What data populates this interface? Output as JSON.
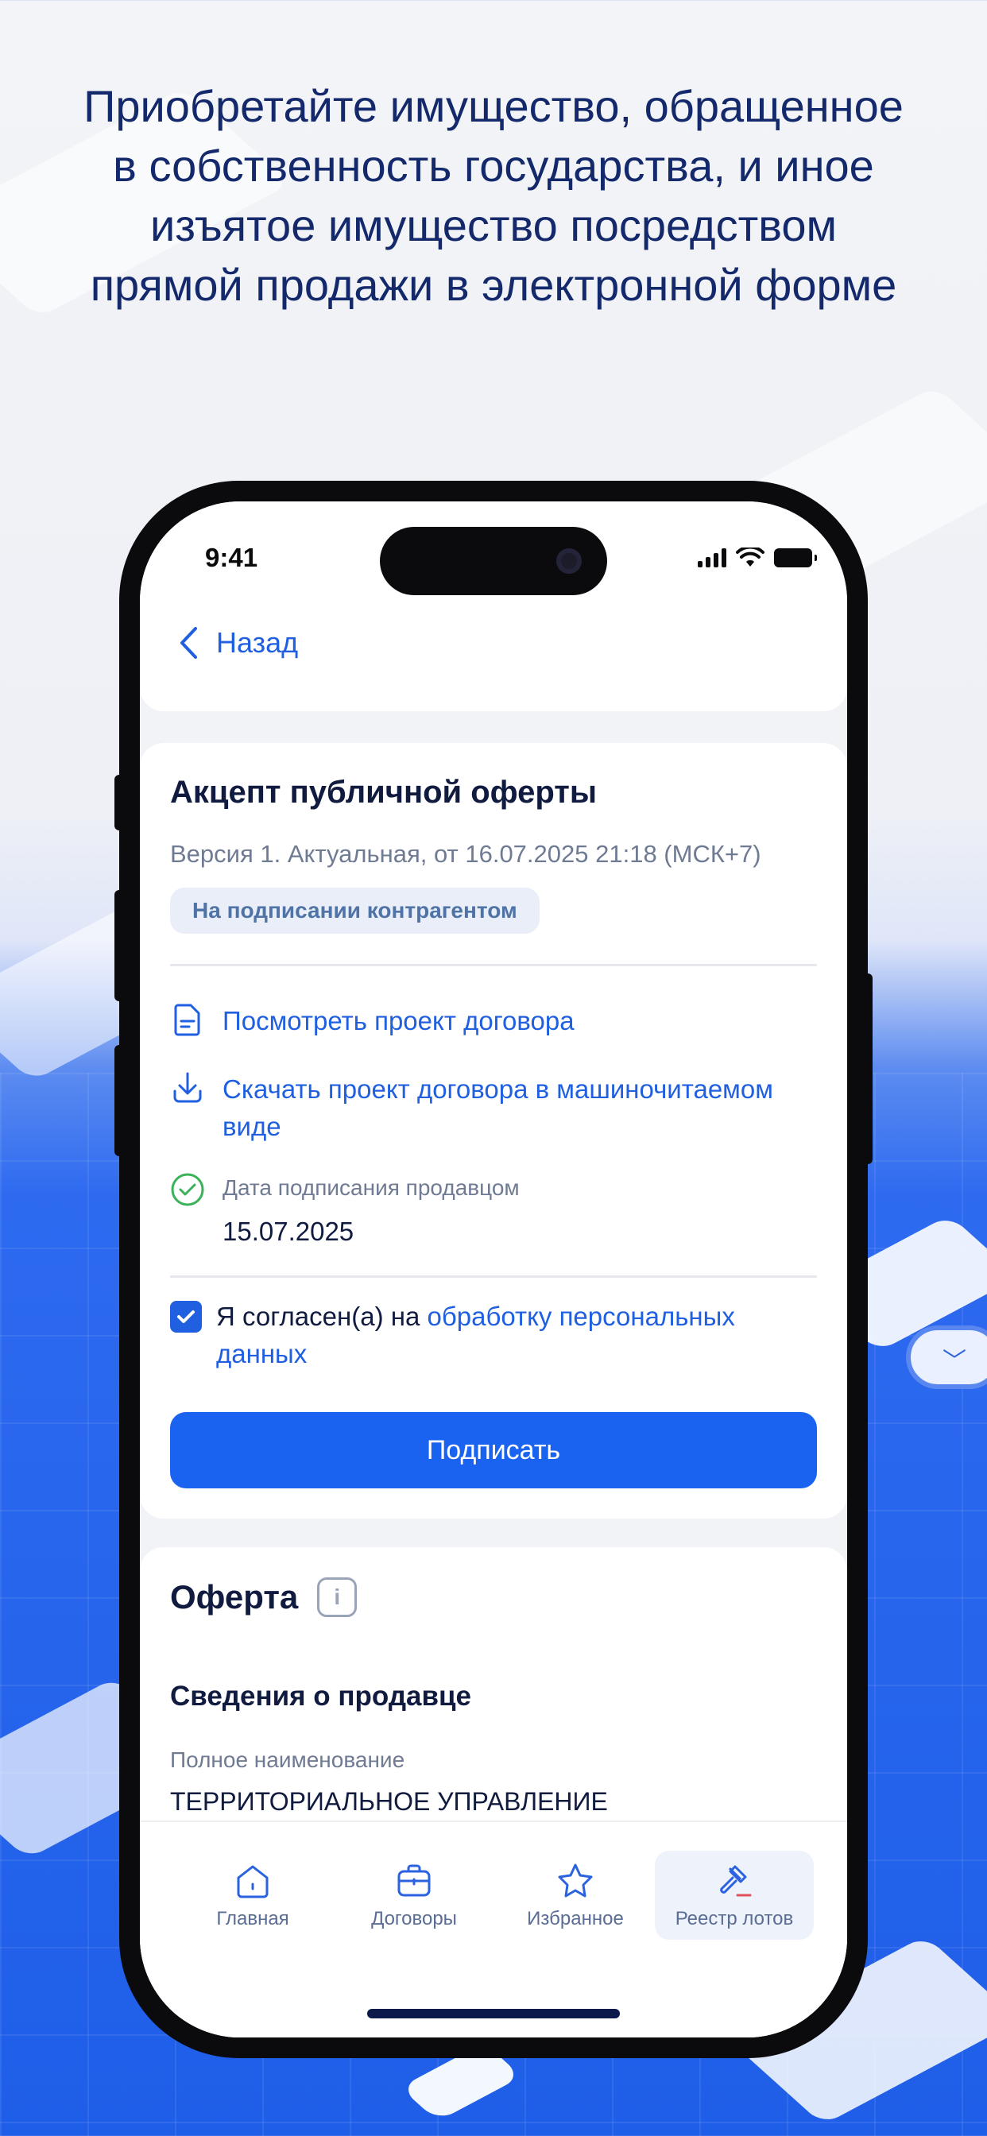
{
  "headline": "Приобретайте имущество, обращенное в собственность государства, и иное изъятое имущество посредством прямой продажи в электронной форме",
  "status_bar": {
    "time": "9:41"
  },
  "nav": {
    "back_label": "Назад"
  },
  "acceptance": {
    "title": "Акцепт публичной оферты",
    "version_text": "Версия 1. Актуальная, от 16.07.2025 21:18 (МСК+7)",
    "status_badge": "На подписании контрагентом",
    "view_draft_link": "Посмотреть проект договора",
    "download_link": "Скачать проект договора в машиночитаемом виде",
    "seller_sign_label": "Дата подписания продавцом",
    "seller_sign_date": "15.07.2025",
    "consent_text": "Я согласен(а) на",
    "consent_link": "обработку персональных данных",
    "consent_checked": true,
    "sign_button": "Подписать"
  },
  "offer": {
    "title": "Оферта",
    "info_icon": "i",
    "seller_section_title": "Сведения о продавце",
    "full_name_label": "Полное наименование",
    "full_name_value": "ТЕРРИТОРИАЛЬНОЕ УПРАВЛЕНИЕ ФЕДЕРАЛЬНОГО АГЕНТСТВА ПО УПРАВЛЕНИЮ"
  },
  "tabbar": {
    "items": [
      {
        "label": "Главная",
        "icon": "home-icon"
      },
      {
        "label": "Договоры",
        "icon": "briefcase-icon"
      },
      {
        "label": "Избранное",
        "icon": "star-icon"
      },
      {
        "label": "Реестр лотов",
        "icon": "gavel-icon",
        "active": true
      }
    ]
  },
  "colors": {
    "accent": "#1a63f0",
    "link": "#1f5fe0",
    "text_primary": "#101b3f",
    "text_secondary": "#6f7a93",
    "success": "#3bb25a"
  }
}
